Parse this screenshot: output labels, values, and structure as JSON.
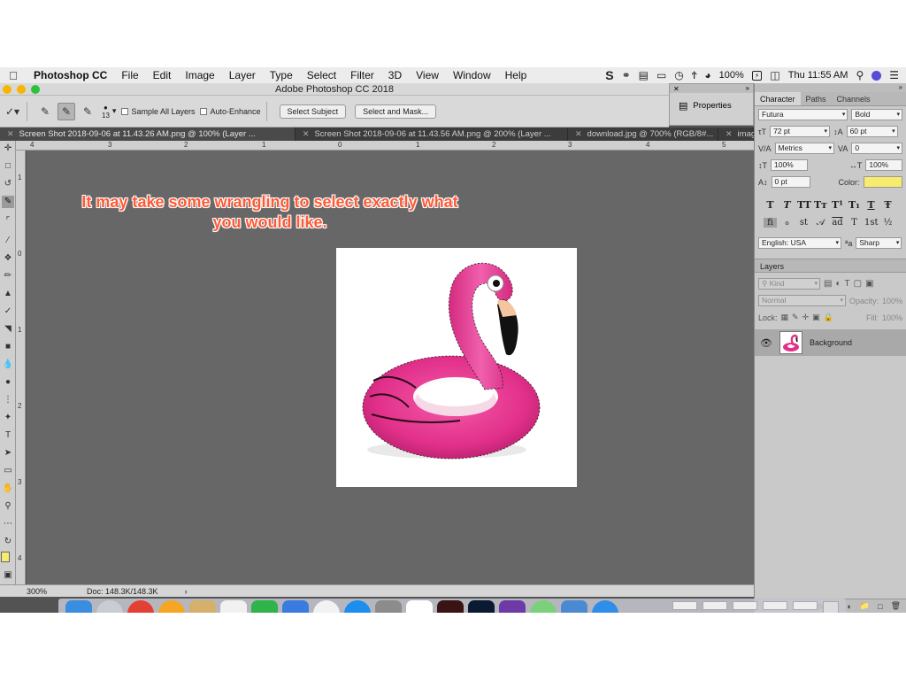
{
  "menubar": {
    "app_name": "Photoshop CC",
    "items": [
      "File",
      "Edit",
      "Image",
      "Layer",
      "Type",
      "Select",
      "Filter",
      "3D",
      "View",
      "Window",
      "Help"
    ],
    "battery": "100%",
    "clock": "Thu 11:55 AM"
  },
  "window": {
    "title": "Adobe Photoshop CC 2018"
  },
  "options_bar": {
    "brush_size": "13",
    "sample_all_layers": "Sample All Layers",
    "auto_enhance": "Auto-Enhance",
    "select_subject": "Select Subject",
    "select_and_mask": "Select and Mask..."
  },
  "tabs": [
    "Screen Shot 2018-09-06 at 11.43.26 AM.png @ 100% (Layer ...",
    "Screen Shot 2018-09-06 at 11.43.56 AM.png @ 200% (Layer ...",
    "download.jpg @ 700% (RGB/8#...",
    "imag"
  ],
  "ruler": {
    "top": [
      "4",
      "3",
      "2",
      "1",
      "0",
      "1",
      "2",
      "3",
      "4",
      "5"
    ],
    "left": [
      "1",
      "0",
      "1",
      "2",
      "3",
      "4"
    ]
  },
  "canvas": {
    "annotation_line1": "It may take some wrangling to select exactly what",
    "annotation_line2": "you would like."
  },
  "status": {
    "zoom": "300%",
    "doc_info": "Doc: 148.3K/148.3K",
    "arrow": "›"
  },
  "properties_dock": {
    "label": "Properties"
  },
  "character_panel": {
    "tabs": [
      "Character",
      "Paths",
      "Channels"
    ],
    "font_family": "Futura",
    "font_style": "Bold",
    "font_size": "72 pt",
    "leading": "60 pt",
    "kerning": "Metrics",
    "tracking": "0",
    "vertical_scale": "100%",
    "horizontal_scale": "100%",
    "baseline_shift": "0 pt",
    "color_label": "Color:",
    "color_value": "#f7ec6e",
    "language": "English: USA",
    "aa_label": "ªa",
    "antialias": "Sharp",
    "style_glyphs": [
      "T",
      "T",
      "TT",
      "Tт",
      "T¹",
      "T₁",
      "T",
      "Ŧ"
    ],
    "opentype_glyphs": [
      "fi",
      "ℴ",
      "st",
      "𝒜",
      "ad",
      "T",
      "1st",
      "½"
    ]
  },
  "layers_panel": {
    "title": "Layers",
    "kind": "Kind",
    "blend_mode": "Normal",
    "opacity_label": "Opacity:",
    "opacity": "100%",
    "lock_label": "Lock:",
    "fill_label": "Fill:",
    "fill": "100%",
    "layer_name": "Background",
    "bottom_icons": [
      "GO",
      "fx"
    ]
  },
  "colors": {
    "flamingo": "#e8318e",
    "accent_orange": "#ff5a36",
    "foreground_swatch": "#f7ec6e"
  }
}
